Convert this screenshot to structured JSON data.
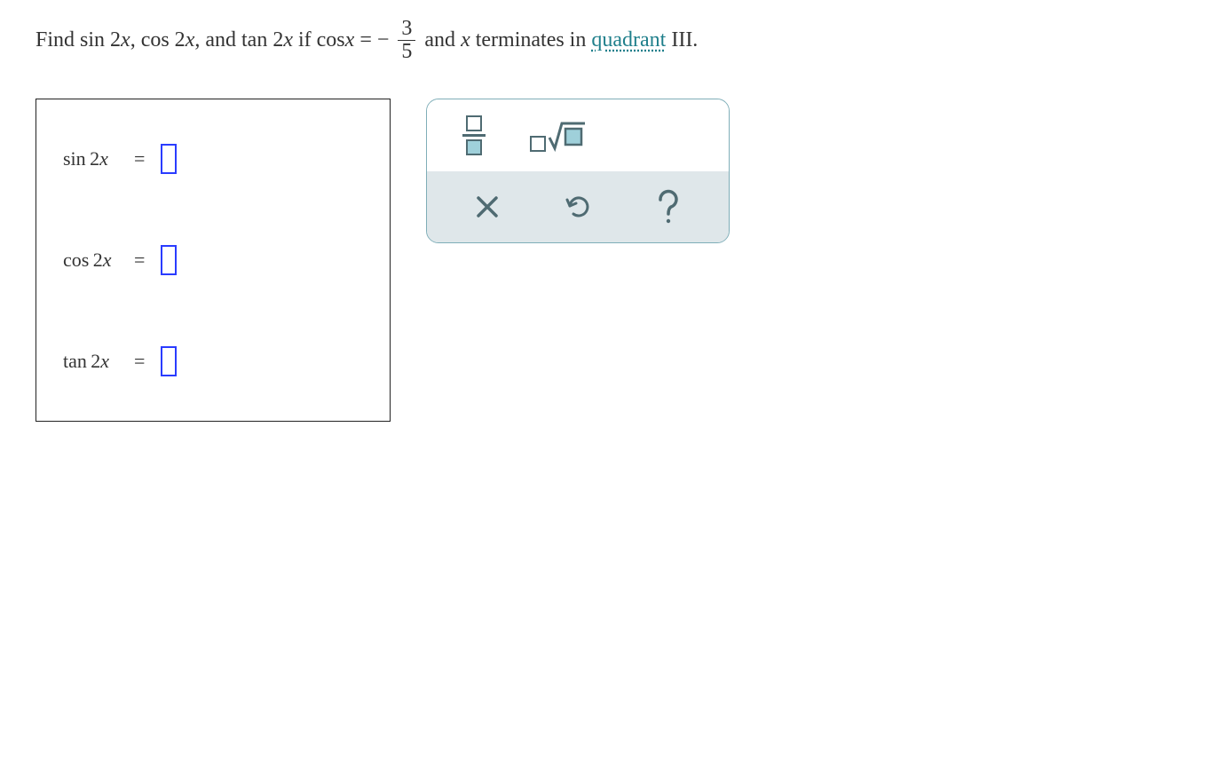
{
  "question": {
    "prefix": "Find",
    "f1": "sin 2",
    "v1": "x",
    "c1": ",",
    "f2": "cos 2",
    "v2": "x",
    "c2": ",",
    "and1": "and",
    "f3": "tan 2",
    "v3": "x",
    "iftxt": "if",
    "cos": "cos",
    "v4": "x",
    "eq": "=",
    "neg": "−",
    "frac_num": "3",
    "frac_den": "5",
    "and2": "and",
    "v5": "x",
    "terminates": "terminates in",
    "link": "quadrant",
    "roman": "III."
  },
  "answers": {
    "row1_label_fn": "sin",
    "row1_label_arg": "2",
    "row1_label_var": "x",
    "row2_label_fn": "cos",
    "row2_label_arg": "2",
    "row2_label_var": "x",
    "row3_label_fn": "tan",
    "row3_label_arg": "2",
    "row3_label_var": "x",
    "equals": "="
  },
  "tools": {
    "fraction": "fraction-template",
    "sqrt": "nth-root-template",
    "clear": "clear",
    "undo": "undo",
    "help": "help"
  }
}
